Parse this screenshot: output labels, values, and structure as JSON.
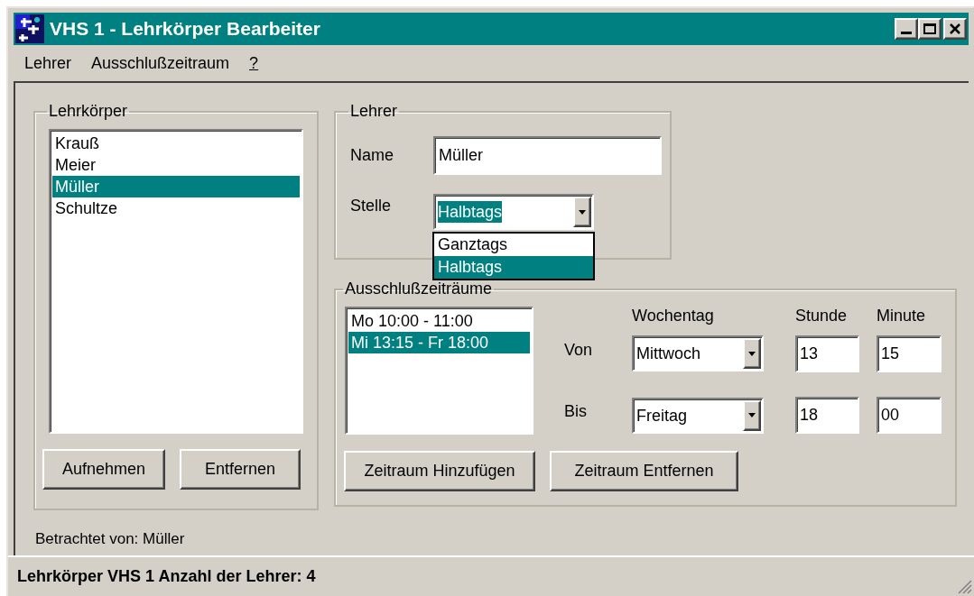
{
  "window": {
    "title": "VHS 1 - Lehrkörper Bearbeiter"
  },
  "menu": [
    {
      "label": "Lehrer",
      "underlined": false
    },
    {
      "label": "Ausschlußzeitraum",
      "underlined": false
    },
    {
      "label": "?",
      "underlined": true
    }
  ],
  "faculty": {
    "title": "Lehrkörper",
    "items": [
      {
        "label": "Krauß",
        "selected": false
      },
      {
        "label": "Meier",
        "selected": false
      },
      {
        "label": "Müller",
        "selected": true
      },
      {
        "label": "Schultze",
        "selected": false
      }
    ],
    "buttons": [
      "Aufnehmen",
      "Entfernen"
    ]
  },
  "teacher": {
    "title": "Lehrer",
    "name_label": "Name",
    "name_value": "Müller",
    "position_label": "Stelle",
    "position_value": "Halbtags",
    "dropdown": {
      "expanded": true,
      "options": [
        {
          "label": "Ganztags",
          "selected": false
        },
        {
          "label": "Halbtags",
          "selected": true
        }
      ]
    }
  },
  "exclusions": {
    "title": "Ausschlußzeiträume",
    "items": [
      {
        "label": "Mo 10:00 - 11:00",
        "selected": false
      },
      {
        "label": "Mi 13:15 - Fr 18:00",
        "selected": true
      }
    ],
    "headers": {
      "weekday": "Wochentag",
      "hour": "Stunde",
      "minute": "Minute"
    },
    "rows": [
      {
        "label": "Von",
        "weekday": "Mittwoch",
        "hour": "13",
        "minute": "15"
      },
      {
        "label": "Bis",
        "weekday": "Freitag",
        "hour": "18",
        "minute": "00"
      }
    ],
    "buttons": [
      "Zeitraum Hinzufügen",
      "Zeitraum Entfernen"
    ]
  },
  "viewed_by": "Betrachtet von: Müller",
  "status_bar": "Lehrkörper VHS 1 Anzahl der Lehrer: 4"
}
